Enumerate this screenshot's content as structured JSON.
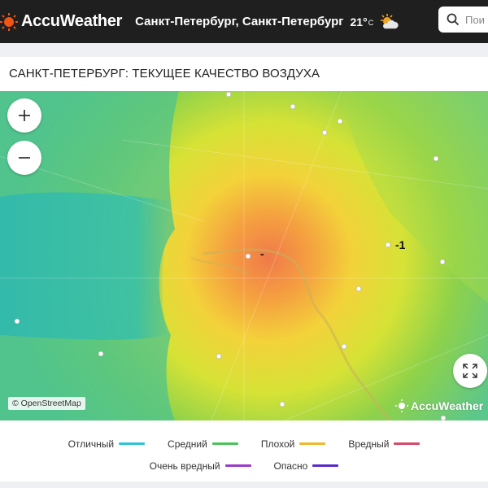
{
  "header": {
    "logo_text": "AccuWeather",
    "location": "Санкт-Петербург, Санкт-Петербург",
    "temperature": "21°",
    "temperature_unit": "C",
    "weather_icon": "partly-sunny-icon",
    "search_placeholder": "Пои"
  },
  "card": {
    "title": "САНКТ-ПЕТЕРБУРГ: ТЕКУЩЕЕ КАЧЕСТВО ВОЗДУХА"
  },
  "map": {
    "zoom_in": "+",
    "zoom_out": "−",
    "attribution": "© OpenStreetMap",
    "watermark": "AccuWeather",
    "aqi_labels": [
      {
        "text": "-"
      },
      {
        "text": "-1"
      }
    ]
  },
  "legend": {
    "rows": [
      [
        {
          "label": "Отличный",
          "color": "#2ec4d8"
        },
        {
          "label": "Средний",
          "color": "#4cc35a"
        },
        {
          "label": "Плохой",
          "color": "#f0b830"
        },
        {
          "label": "Вредный",
          "color": "#d84a6a"
        }
      ],
      [
        {
          "label": "Очень вредный",
          "color": "#9a3cc8"
        },
        {
          "label": "Опасно",
          "color": "#5a2cc8"
        }
      ]
    ]
  }
}
